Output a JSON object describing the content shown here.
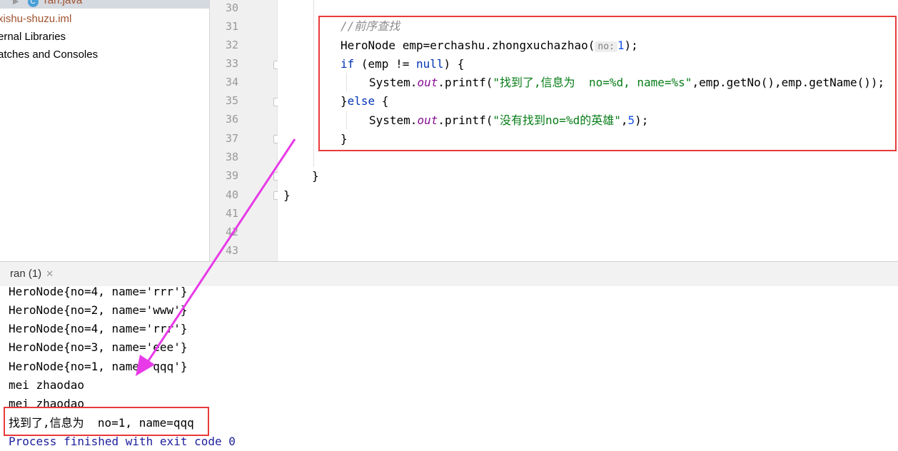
{
  "project_tree": {
    "file_java": "ran.java",
    "file_iml": "xishu-shuzu.iml",
    "external_libraries": "ernal Libraries",
    "scratches": "atches and Consoles"
  },
  "editor": {
    "line_numbers": [
      "30",
      "31",
      "32",
      "33",
      "34",
      "35",
      "36",
      "37",
      "38",
      "39",
      "40",
      "41",
      "42",
      "43"
    ],
    "comment": "//前序查找",
    "line32": {
      "type": "HeroNode",
      "var": " emp=erchashu.zhongxuchazhao(",
      "hint": "no:",
      "num": "1",
      "end": ");"
    },
    "line33": {
      "kw_if": "if",
      "cond": " (emp != ",
      "kw_null": "null",
      "end": ") {"
    },
    "line34": {
      "sys": "System.",
      "out": "out",
      "printf": ".printf(",
      "str": "\"找到了,信息为  no=%d, name=%s\"",
      "args": ",emp.getNo(),emp.getName());"
    },
    "line35": {
      "close": "}",
      "kw_else": "else",
      "end": " {"
    },
    "line36": {
      "sys": "System.",
      "out": "out",
      "printf": ".printf(",
      "str": "\"没有找到no=%d的英雄\"",
      "comma": ",",
      "num": "5",
      "end": ");"
    },
    "line37": "}",
    "line39": "}",
    "line40": "}"
  },
  "run_tab": {
    "label": "ran (1)",
    "close": "✕"
  },
  "console": {
    "lines": [
      "HeroNode{no=4, name='rrr'}",
      "HeroNode{no=2, name='www'}",
      "HeroNode{no=4, name='rrr'}",
      "HeroNode{no=3, name='eee'}",
      "HeroNode{no=1, name='qqq'}",
      "mei zhaodao",
      "mei zhaodao",
      "找到了,信息为  no=1, name=qqq"
    ],
    "exit_message": "Process finished with exit code 0"
  },
  "colors": {
    "annotation_red": "#e83a3a",
    "arrow_magenta": "#e83ae8"
  }
}
